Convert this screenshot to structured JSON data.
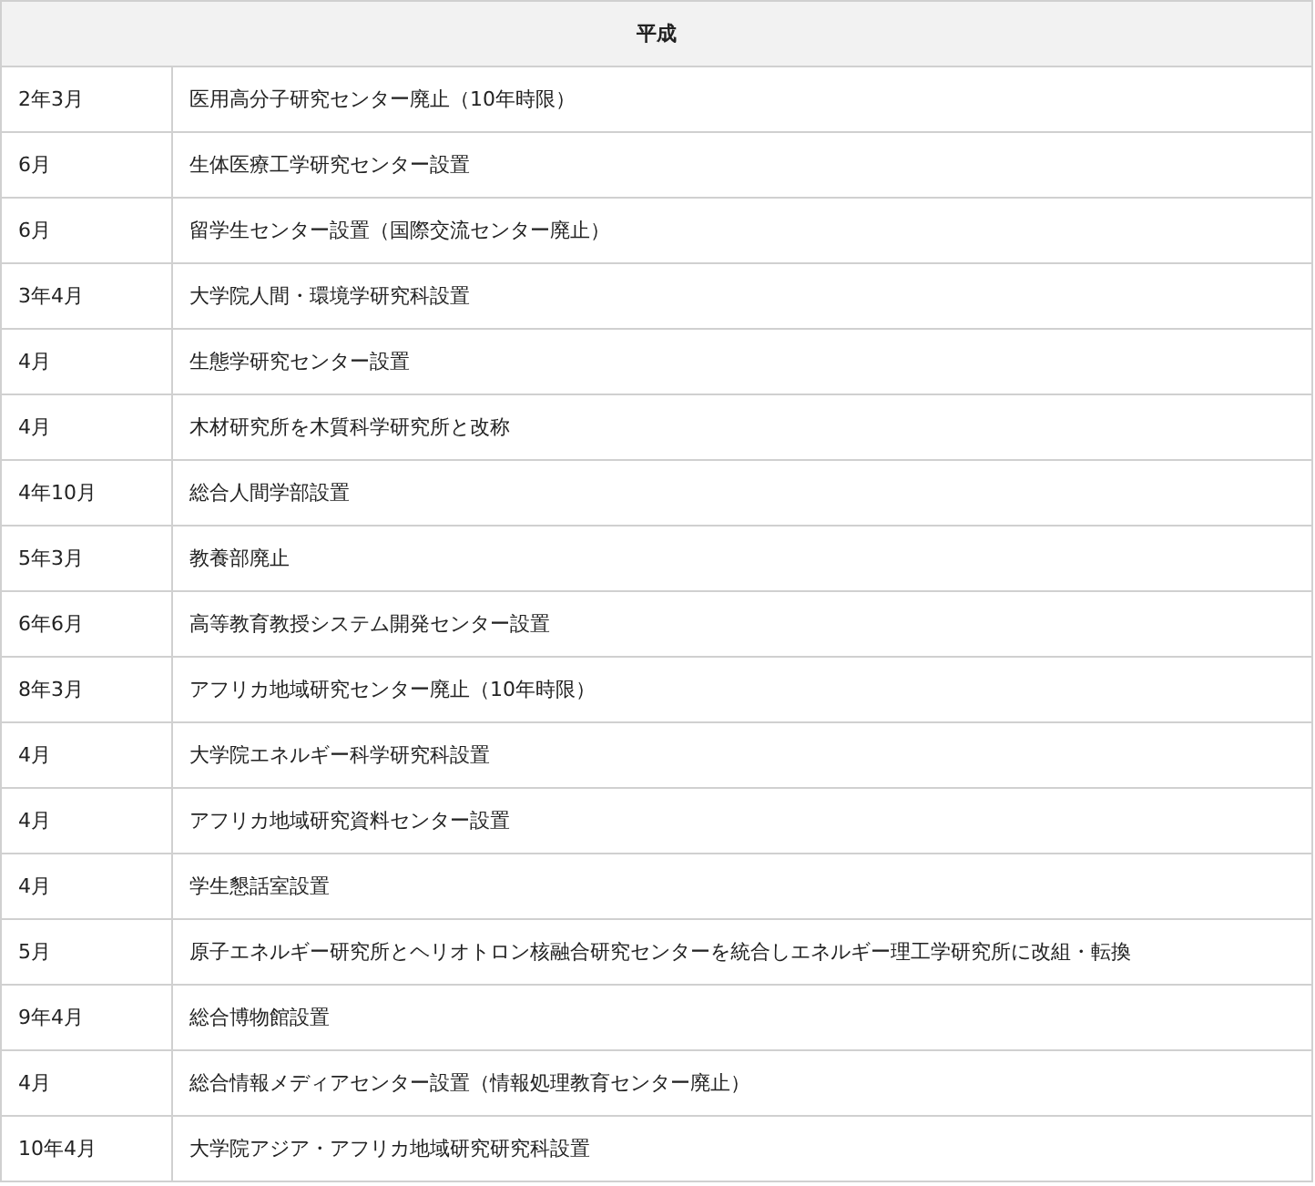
{
  "table": {
    "header": "平成",
    "rows": [
      {
        "date": "2年3月",
        "event": "医用高分子研究センター廃止（10年時限）"
      },
      {
        "date": "6月",
        "event": "生体医療工学研究センター設置"
      },
      {
        "date": "6月",
        "event": "留学生センター設置（国際交流センター廃止）"
      },
      {
        "date": "3年4月",
        "event": "大学院人間・環境学研究科設置"
      },
      {
        "date": "4月",
        "event": "生態学研究センター設置"
      },
      {
        "date": "4月",
        "event": "木材研究所を木質科学研究所と改称"
      },
      {
        "date": "4年10月",
        "event": "総合人間学部設置"
      },
      {
        "date": "5年3月",
        "event": "教養部廃止"
      },
      {
        "date": "6年6月",
        "event": "高等教育教授システム開発センター設置"
      },
      {
        "date": "8年3月",
        "event": "アフリカ地域研究センター廃止（10年時限）"
      },
      {
        "date": "4月",
        "event": "大学院エネルギー科学研究科設置"
      },
      {
        "date": "4月",
        "event": "アフリカ地域研究資料センター設置"
      },
      {
        "date": "4月",
        "event": "学生懇話室設置"
      },
      {
        "date": "5月",
        "event": "原子エネルギー研究所とヘリオトロン核融合研究センターを統合しエネルギー理工学研究所に改組・転換"
      },
      {
        "date": "9年4月",
        "event": "総合博物館設置"
      },
      {
        "date": "4月",
        "event": "総合情報メディアセンター設置（情報処理教育センター廃止）"
      },
      {
        "date": "10年4月",
        "event": "大学院アジア・アフリカ地域研究研究科設置"
      }
    ]
  }
}
